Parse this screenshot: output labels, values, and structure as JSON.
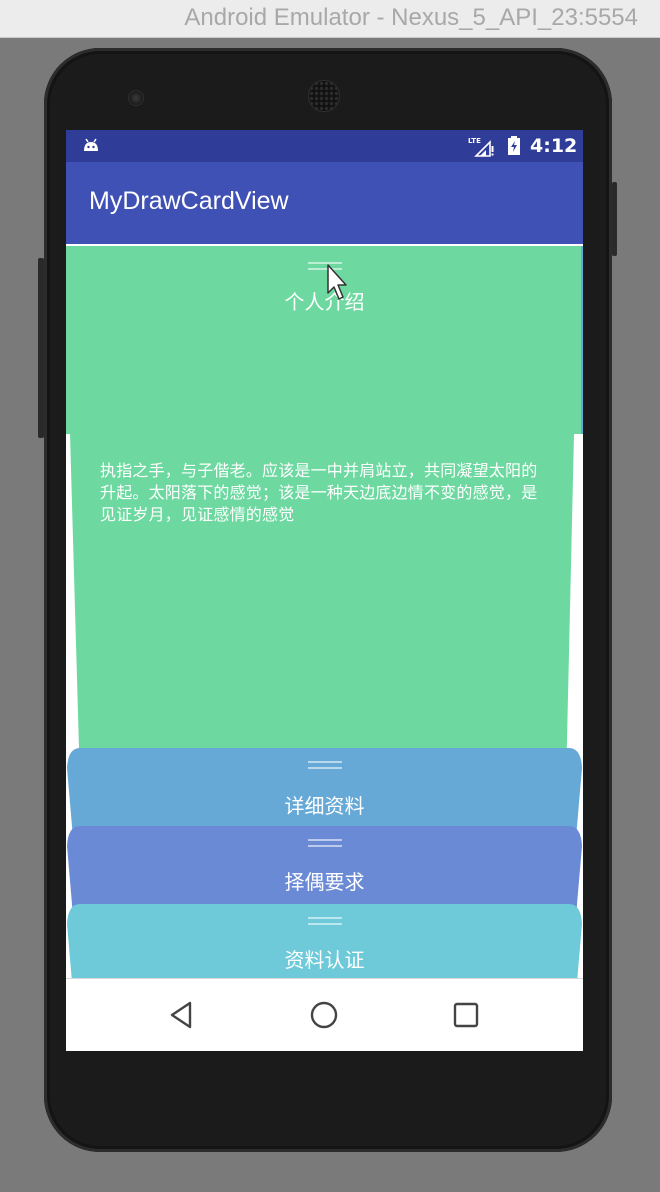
{
  "window": {
    "title": "Android Emulator - Nexus_5_API_23:5554"
  },
  "device": {
    "name": "Nexus 5"
  },
  "status_bar": {
    "network": "LTE",
    "time": "4:12",
    "icons": [
      "android-icon",
      "lte-signal-icon",
      "battery-icon"
    ]
  },
  "app_bar": {
    "title": "MyDrawCardView"
  },
  "cards": [
    {
      "title": "个人介绍",
      "body": "执指之手，与子偕老。应该是一中并肩站立，共同凝望太阳的升起。太阳落下的感觉；该是一种天边底边情不变的感觉，是见证岁月，见证感情的感觉",
      "color": "#6dd9a0",
      "expanded": true
    },
    {
      "title": "详细资料",
      "color": "#66a8d6",
      "expanded": false
    },
    {
      "title": "择偶要求",
      "color": "#6b8ad6",
      "expanded": false
    },
    {
      "title": "资料认证",
      "color": "#6ecad9",
      "expanded": false
    }
  ],
  "nav_bar": {
    "buttons": [
      "back-icon",
      "home-icon",
      "recents-icon"
    ]
  },
  "colors": {
    "status_bar": "#2f3d99",
    "app_bar": "#3f51b5",
    "screen_background": "#ffffff"
  }
}
